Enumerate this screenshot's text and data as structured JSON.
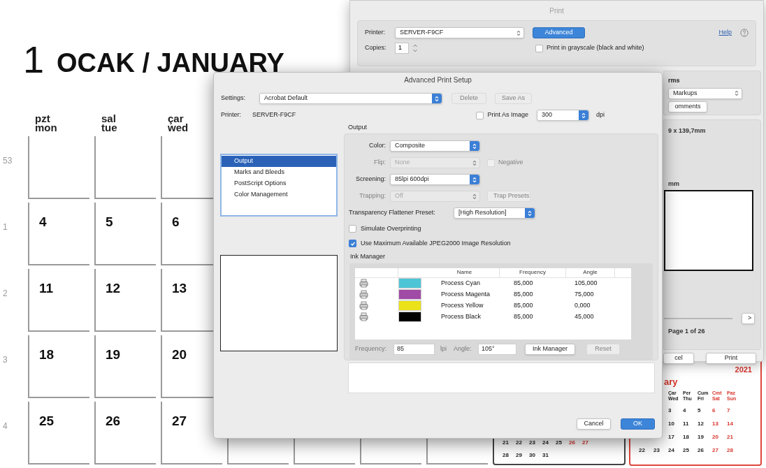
{
  "wall_calendar": {
    "day_number": "1",
    "title": "OCAK / JANUARY",
    "weekdays": [
      {
        "tr": "pzt",
        "en": "mon"
      },
      {
        "tr": "sal",
        "en": "tue"
      },
      {
        "tr": "çar",
        "en": "wed"
      }
    ],
    "weeks": [
      {
        "number": "53"
      },
      {
        "number": "1",
        "days": [
          "4",
          "5",
          "6"
        ]
      },
      {
        "number": "2",
        "days": [
          "11",
          "12",
          "13"
        ]
      },
      {
        "number": "3",
        "days": [
          "18",
          "19",
          "20"
        ]
      },
      {
        "number": "4",
        "days": [
          "25",
          "26",
          "27"
        ]
      }
    ]
  },
  "month_calendar": {
    "weeks": [
      [
        {
          "day": "21",
          "weekend": false
        },
        {
          "day": "22",
          "weekend": false
        },
        {
          "day": "23",
          "weekend": false
        },
        {
          "day": "24",
          "weekend": false
        },
        {
          "day": "25",
          "weekend": false
        },
        {
          "day": "26",
          "weekend": true
        },
        {
          "day": "27",
          "weekend": true
        }
      ],
      [
        {
          "day": "28",
          "weekend": false
        },
        {
          "day": "29",
          "weekend": false
        },
        {
          "day": "30",
          "weekend": false
        },
        {
          "day": "31",
          "weekend": false
        }
      ]
    ]
  },
  "next_calendar": {
    "year": "2021",
    "month": "ary",
    "weekdays": [
      {
        "tr": "Çar",
        "en": "Wed",
        "weekend": false
      },
      {
        "tr": "Per",
        "en": "Thu",
        "weekend": false
      },
      {
        "tr": "Cum",
        "en": "Fri",
        "weekend": false
      },
      {
        "tr": "Cmt",
        "en": "Sat",
        "weekend": true
      },
      {
        "tr": "Paz",
        "en": "Sun",
        "weekend": true
      }
    ],
    "weeks": [
      [
        {
          "day": "3",
          "weekend": false
        },
        {
          "day": "4",
          "weekend": false
        },
        {
          "day": "5",
          "weekend": false
        },
        {
          "day": "6",
          "weekend": true
        },
        {
          "day": "7",
          "weekend": true
        }
      ],
      [
        {
          "day": "10",
          "weekend": false
        },
        {
          "day": "11",
          "weekend": false
        },
        {
          "day": "12",
          "weekend": false
        },
        {
          "day": "13",
          "weekend": true
        },
        {
          "day": "14",
          "weekend": true
        }
      ],
      [
        {
          "day": "17",
          "weekend": false
        },
        {
          "day": "18",
          "weekend": false
        },
        {
          "day": "19",
          "weekend": false
        },
        {
          "day": "20",
          "weekend": true
        },
        {
          "day": "21",
          "weekend": true
        }
      ],
      [
        {
          "day": "22",
          "weekend": false
        },
        {
          "day": "23",
          "weekend": false
        },
        {
          "day": "24",
          "weekend": false
        },
        {
          "day": "25",
          "weekend": false
        },
        {
          "day": "26",
          "weekend": false
        },
        {
          "day": "27",
          "weekend": true
        },
        {
          "day": "28",
          "weekend": true
        }
      ]
    ]
  },
  "print_dialog": {
    "title": "Print",
    "printer_label": "Printer:",
    "printer": "SERVER-F9CF",
    "advanced": "Advanced",
    "help": "Help",
    "copies_label": "Copies:",
    "copies": "1",
    "grayscale": {
      "label": "Print in grayscale (black and white)",
      "checked": false
    },
    "forms_heading": "rms",
    "markups": "Markups",
    "comments_button": "omments",
    "page_size": "9 x 139,7mm",
    "scale_size": "mm",
    "next_page": ">",
    "page_info": "Page 1 of 26",
    "buttons": [
      {
        "label": "cel",
        "primary": false
      },
      {
        "label": "Print",
        "primary": false
      }
    ]
  },
  "advanced_dialog": {
    "title": "Advanced Print Setup",
    "settings_label": "Settings:",
    "settings": "Acrobat Default",
    "buttons": [
      {
        "label": "Delete",
        "disabled": true
      },
      {
        "label": "Save As",
        "disabled": true
      }
    ],
    "printer_label": "Printer:",
    "printer": "SERVER-F9CF",
    "print_as_image": {
      "label": "Print As Image",
      "checked": false
    },
    "resolution": "300",
    "resolution_unit": "dpi",
    "sections": [
      {
        "label": "Output",
        "selected": true
      },
      {
        "label": "Marks and Bleeds",
        "selected": false
      },
      {
        "label": "PostScript Options",
        "selected": false
      },
      {
        "label": "Color Management",
        "selected": false
      }
    ],
    "output": {
      "heading": "Output",
      "rows": [
        {
          "label": "Color:",
          "value": "Composite",
          "disabled": false
        },
        {
          "label": "Flip:",
          "value": "None",
          "disabled": true,
          "companion": {
            "kind": "checkbox",
            "label": "Negative",
            "checked": false,
            "disabled": true
          }
        },
        {
          "label": "Screening:",
          "value": "85lpi 600dpi",
          "disabled": false
        },
        {
          "label": "Trapping:",
          "value": "Off",
          "disabled": true,
          "companion": {
            "kind": "button",
            "label": "Trap Presets",
            "disabled": true
          }
        }
      ],
      "flattener": {
        "label": "Transparency Flattener Preset:",
        "value": "[High Resolution]"
      },
      "options": [
        {
          "label": "Simulate Overprinting",
          "checked": false
        },
        {
          "label": "Use Maximum Available JPEG2000 Image Resolution",
          "checked": true
        }
      ]
    },
    "ink_manager": {
      "heading": "Ink Manager",
      "columns": [
        "Name",
        "Frequency",
        "Angle"
      ],
      "inks": [
        {
          "name": "Process Cyan",
          "frequency": "85,000",
          "angle": "105,000",
          "color": "#4ec5d6"
        },
        {
          "name": "Process Magenta",
          "frequency": "85,000",
          "angle": "75,000",
          "color": "#a04ba6"
        },
        {
          "name": "Process Yellow",
          "frequency": "85,000",
          "angle": "0,000",
          "color": "#ece21a"
        },
        {
          "name": "Process Black",
          "frequency": "85,000",
          "angle": "45,000",
          "color": "#000000"
        }
      ],
      "frequency_label": "Frequency:",
      "frequency": "85",
      "frequency_unit": "lpi",
      "angle_label": "Angle:",
      "angle": "105°",
      "buttons": [
        {
          "label": "Ink Manager",
          "disabled": false
        },
        {
          "label": "Reset",
          "disabled": true
        }
      ]
    },
    "footer_buttons": [
      {
        "label": "Cancel",
        "primary": false
      },
      {
        "label": "OK",
        "primary": true
      }
    ]
  }
}
